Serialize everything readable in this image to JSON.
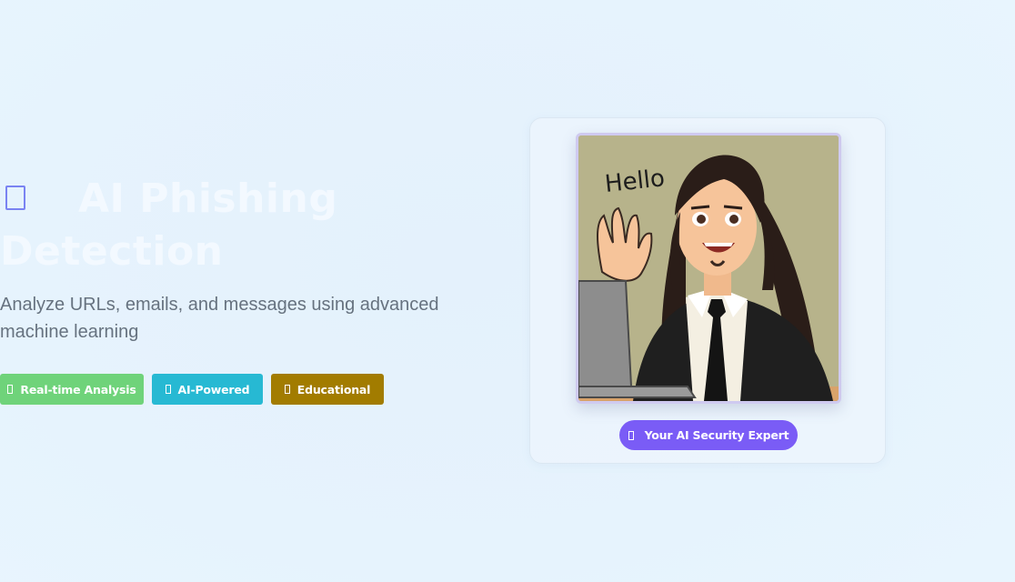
{
  "hero": {
    "title_line1": "AI Phishing",
    "title_line2": "Detection",
    "title_icon": "shield-icon",
    "subtitle": "Analyze URLs, emails, and messages using advanced machine learning"
  },
  "badges": [
    {
      "label": "Real-time Analysis",
      "icon": "bolt-icon",
      "color": "#6fd37a"
    },
    {
      "label": "AI-Powered",
      "icon": "robot-icon",
      "color": "#27b9d3"
    },
    {
      "label": "Educational",
      "icon": "graduation-cap-icon",
      "color": "#a27c00"
    }
  ],
  "mascot": {
    "speech_text": "Hello",
    "caption": "Your AI Security Expert",
    "caption_icon": "robot-icon",
    "caption_color": "#7a5cf6"
  },
  "colors": {
    "background": "#e6f3fd",
    "title": "#f3f9ff",
    "subtitle": "#66727f",
    "accent": "#7a83f2"
  }
}
